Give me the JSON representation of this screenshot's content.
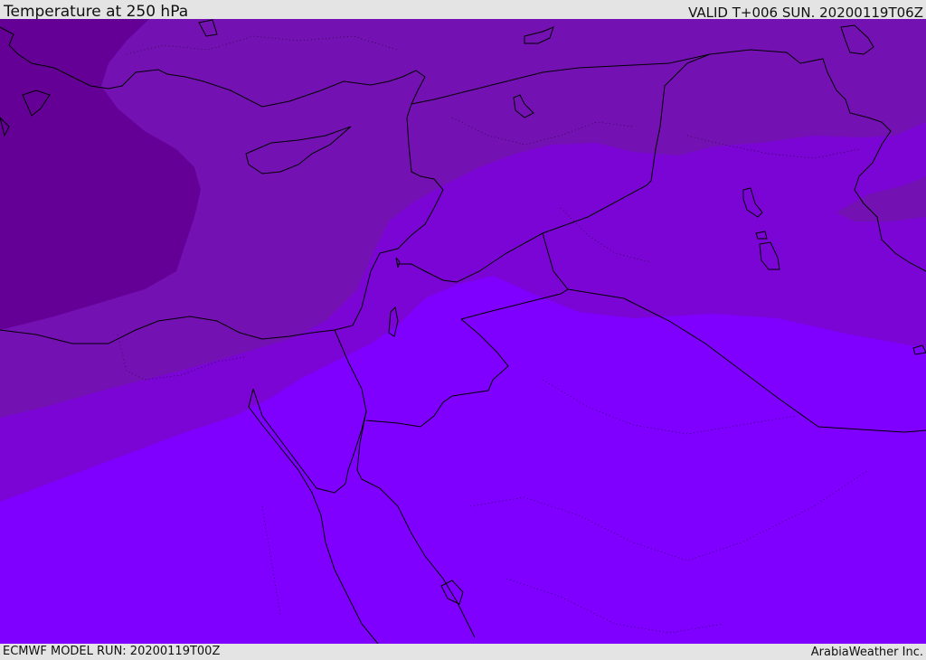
{
  "header": {
    "title": "Temperature at 250 hPa",
    "valid": "VALID T+006 SUN. 20200119T06Z"
  },
  "footer": {
    "model_run": "ECMWF MODEL RUN: 20200119T00Z",
    "credit": "ArabiaWeather Inc."
  },
  "map": {
    "colors": {
      "band_coldest": "#640096",
      "band_cold": "#7411b3",
      "band_mid": "#7a05d4",
      "band_warm": "#7f00ff",
      "coastline": "#000000"
    }
  }
}
